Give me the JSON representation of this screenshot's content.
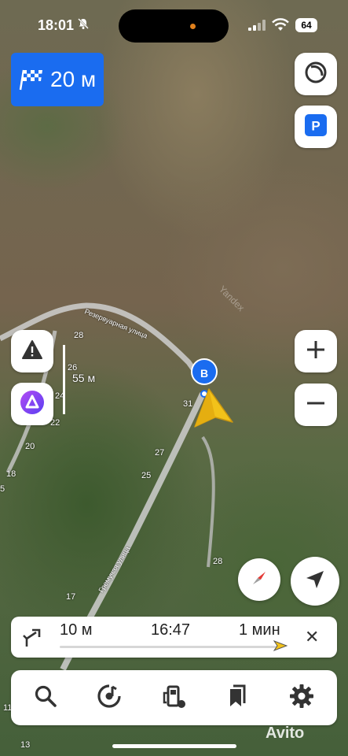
{
  "status_bar": {
    "time": "18:01",
    "battery": "64"
  },
  "navigation": {
    "distance_to_turn": "20 м"
  },
  "map": {
    "scale_label": "55 м",
    "destination_pin": "B",
    "watermark": "Yandex",
    "road_labels": [
      "Резервуарная улица",
      "Гремучая улица"
    ],
    "house_numbers": [
      "28",
      "26",
      "24",
      "22",
      "20",
      "18",
      "5",
      "31",
      "27",
      "25",
      "28",
      "17",
      "11",
      "13"
    ]
  },
  "route_summary": {
    "distance": "10 м",
    "arrival": "16:47",
    "duration": "1 мин"
  },
  "overlay": {
    "avito": "Avito"
  },
  "colors": {
    "accent": "#1a6cf0",
    "pointer": "#f2c21a",
    "alice": "#7b3ff2"
  }
}
